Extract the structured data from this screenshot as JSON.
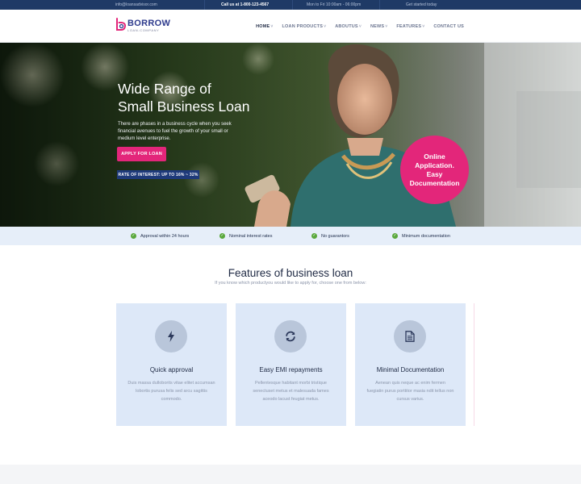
{
  "topbar": {
    "email": "info@loansadvisor.com",
    "call": "Call us at 1-800-123-4567",
    "hours": "Mon to Fri 10:00am - 06:00pm",
    "get_started": "Get started today"
  },
  "logo": {
    "title": "BORROW",
    "subtitle": "LOAN-COMPANY"
  },
  "nav": {
    "items": [
      {
        "label": "HOME"
      },
      {
        "label": "LOAN PRODUCTS"
      },
      {
        "label": "ABOUTUS"
      },
      {
        "label": "NEWS"
      },
      {
        "label": "FEATURES"
      },
      {
        "label": "CONTACT US"
      }
    ]
  },
  "hero": {
    "title_line1": "Wide Range of",
    "title_line2": "Small Business Loan",
    "description": "There are phases in a business cycle when you seek financial avenues to fuel the growth of your small or medium level enterprise.",
    "apply_label": "APPLY FOR LOAN",
    "rate_label": "RATE OF INTEREST: UP TO 16% ~ 32%",
    "online_line1": "Online",
    "online_line2": "Application.",
    "online_line3": "Easy",
    "online_line4": "Documentation"
  },
  "benefits": [
    {
      "label": "Approval within 24 hours"
    },
    {
      "label": "Nominal interest rates"
    },
    {
      "label": "No guarantors"
    },
    {
      "label": "Minimum documentation"
    }
  ],
  "features": {
    "title": "Features of business loan",
    "subtitle": "If you know which productyou would like to apply for, choose one from below:",
    "cards": [
      {
        "icon": "bolt-icon",
        "title": "Quick approval",
        "text": "Duis massa dulloborits vitae elitet accumsan lobortis purusa felis sed arcu sagittis commodo."
      },
      {
        "icon": "refresh-icon",
        "title": "Easy EMI repayments",
        "text": "Pellentesque habitant morbi tristique senectuset metus et malesuada fames aceodo lacust feugiat metus."
      },
      {
        "icon": "document-icon",
        "title": "Minimal Documentation",
        "text": "Aenean quis neque ac enim fermen fuegiatin purus porttitor masia ndit tellus non cursus varius."
      }
    ]
  },
  "colors": {
    "topbar": "#1f3a66",
    "accent_pink": "#e3267a",
    "navy": "#1e3a7a",
    "card_bg": "#dde8f8",
    "check_green": "#5aa83c"
  }
}
